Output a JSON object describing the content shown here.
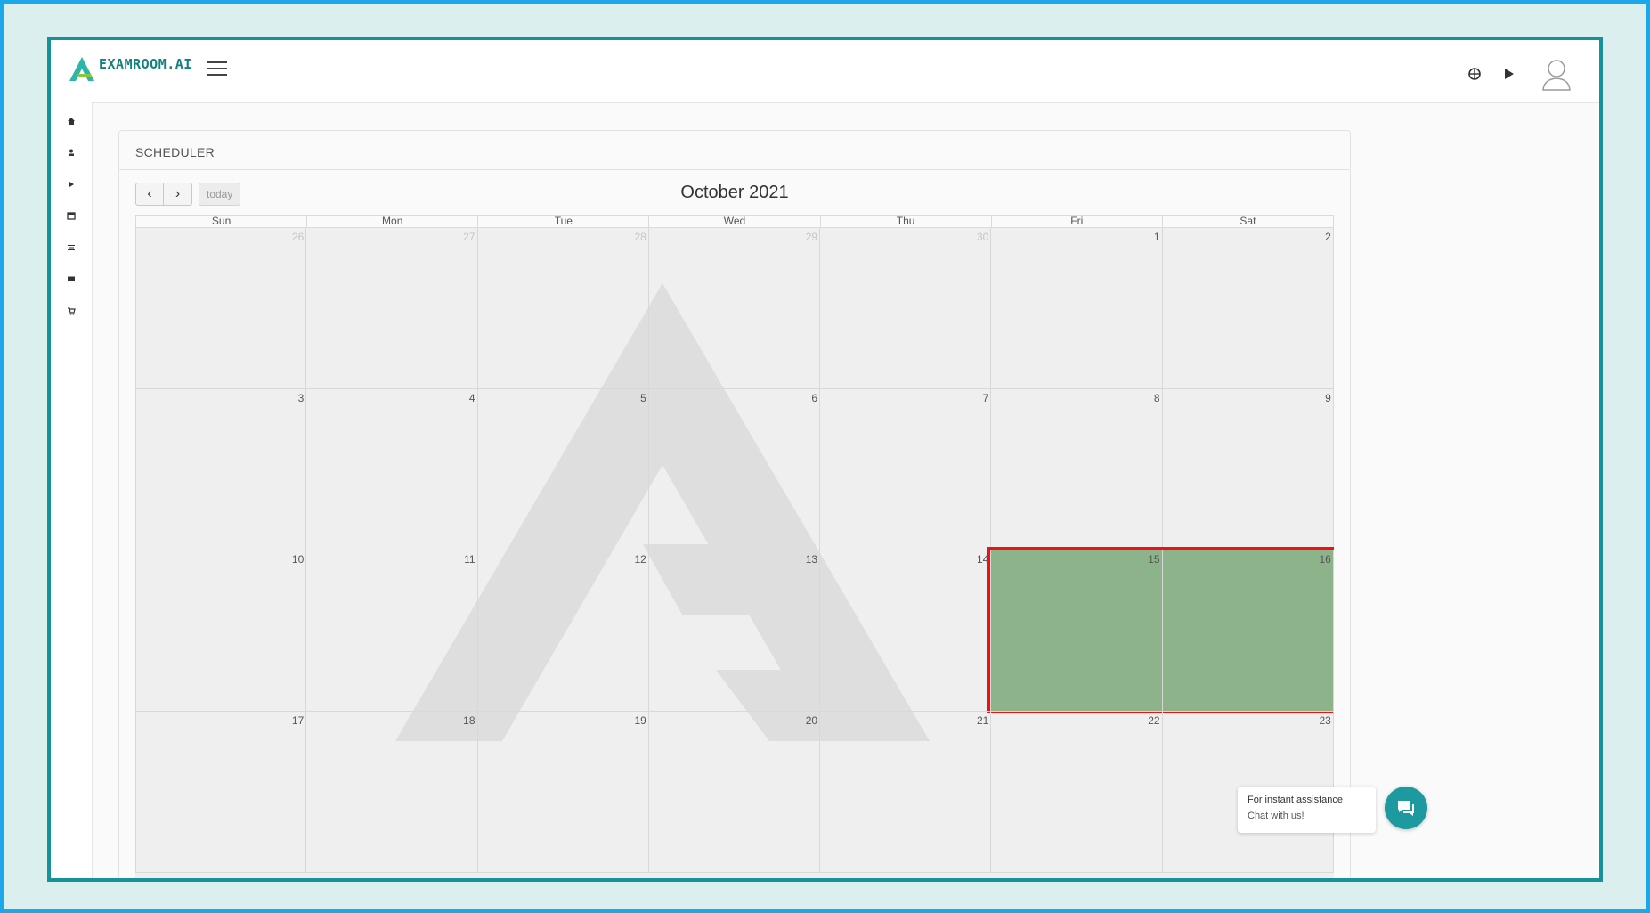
{
  "app": {
    "logo_text": "EXAMROOM.AI",
    "brand_color": "#14807f",
    "frame_color": "#16929a",
    "outer_border_color": "#1ca8e8"
  },
  "header": {
    "icons": [
      "menu-icon",
      "globe-icon",
      "play-icon",
      "avatar-icon"
    ]
  },
  "sidebar": {
    "items": [
      {
        "icon": "home-icon"
      },
      {
        "icon": "user-icon"
      },
      {
        "icon": "play-icon"
      },
      {
        "icon": "calendar-icon"
      },
      {
        "icon": "list-icon"
      },
      {
        "icon": "mail-icon"
      },
      {
        "icon": "cart-icon"
      }
    ]
  },
  "scheduler": {
    "title": "SCHEDULER",
    "prev_label": "‹",
    "next_label": "›",
    "today_label": "today",
    "month_title": "October 2021",
    "weekdays": [
      "Sun",
      "Mon",
      "Tue",
      "Wed",
      "Thu",
      "Fri",
      "Sat"
    ],
    "available_color": "#8db38a",
    "highlight_color": "#ee1111",
    "weeks": [
      [
        {
          "label": "26",
          "other": true
        },
        {
          "label": "27",
          "other": true
        },
        {
          "label": "28",
          "other": true
        },
        {
          "label": "29",
          "other": true
        },
        {
          "label": "30",
          "other": true
        },
        {
          "label": "1"
        },
        {
          "label": "2"
        }
      ],
      [
        {
          "label": "3"
        },
        {
          "label": "4"
        },
        {
          "label": "5"
        },
        {
          "label": "6"
        },
        {
          "label": "7"
        },
        {
          "label": "8"
        },
        {
          "label": "9"
        }
      ],
      [
        {
          "label": "10"
        },
        {
          "label": "11"
        },
        {
          "label": "12"
        },
        {
          "label": "13"
        },
        {
          "label": "14"
        },
        {
          "label": "15",
          "available": true,
          "highlighted": true
        },
        {
          "label": "16",
          "available": true,
          "highlighted": true
        }
      ],
      [
        {
          "label": "17"
        },
        {
          "label": "18"
        },
        {
          "label": "19"
        },
        {
          "label": "20"
        },
        {
          "label": "21"
        },
        {
          "label": "22"
        },
        {
          "label": "23"
        }
      ]
    ]
  },
  "chat": {
    "line1": "For instant assistance",
    "line2": "Chat with us!",
    "color": "#1d9aa0"
  }
}
